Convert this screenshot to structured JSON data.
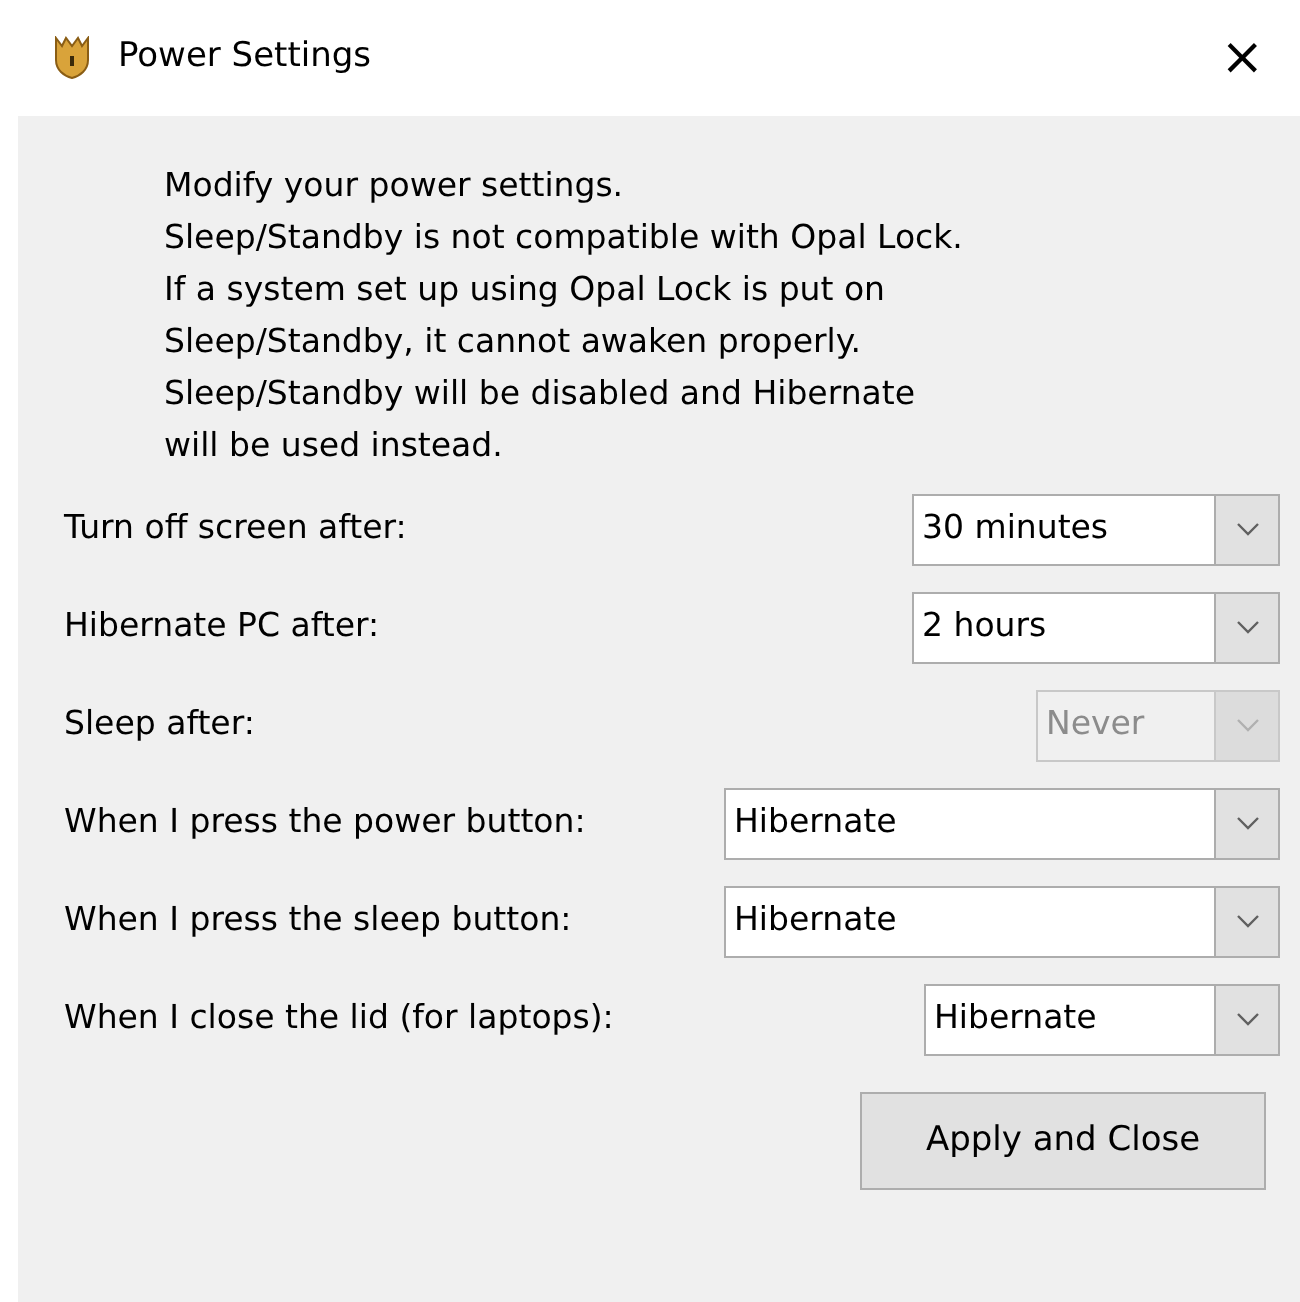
{
  "window": {
    "title": "Power Settings",
    "close": "×"
  },
  "message": [
    "Modify your power settings.",
    "Sleep/Standby is not compatible with Opal Lock.",
    "If a system set up using Opal Lock is put on",
    "Sleep/Standby, it cannot awaken properly.",
    "Sleep/Standby will be disabled and Hibernate",
    "will be used instead."
  ],
  "settings": [
    {
      "label": "Turn off screen after:",
      "value": "30 minutes",
      "disabled": false
    },
    {
      "label": "Hibernate PC after:",
      "value": "2 hours",
      "disabled": false
    },
    {
      "label": "Sleep after:",
      "value": "Never",
      "disabled": true
    },
    {
      "label": "When I press the power button:",
      "value": "Hibernate",
      "disabled": false
    },
    {
      "label": "When I press the sleep button:",
      "value": "Hibernate",
      "disabled": false
    },
    {
      "label": "When I close the lid (for laptops):",
      "value": "Hibernate",
      "disabled": false
    }
  ],
  "buttons": [
    "Apply and Close"
  ]
}
